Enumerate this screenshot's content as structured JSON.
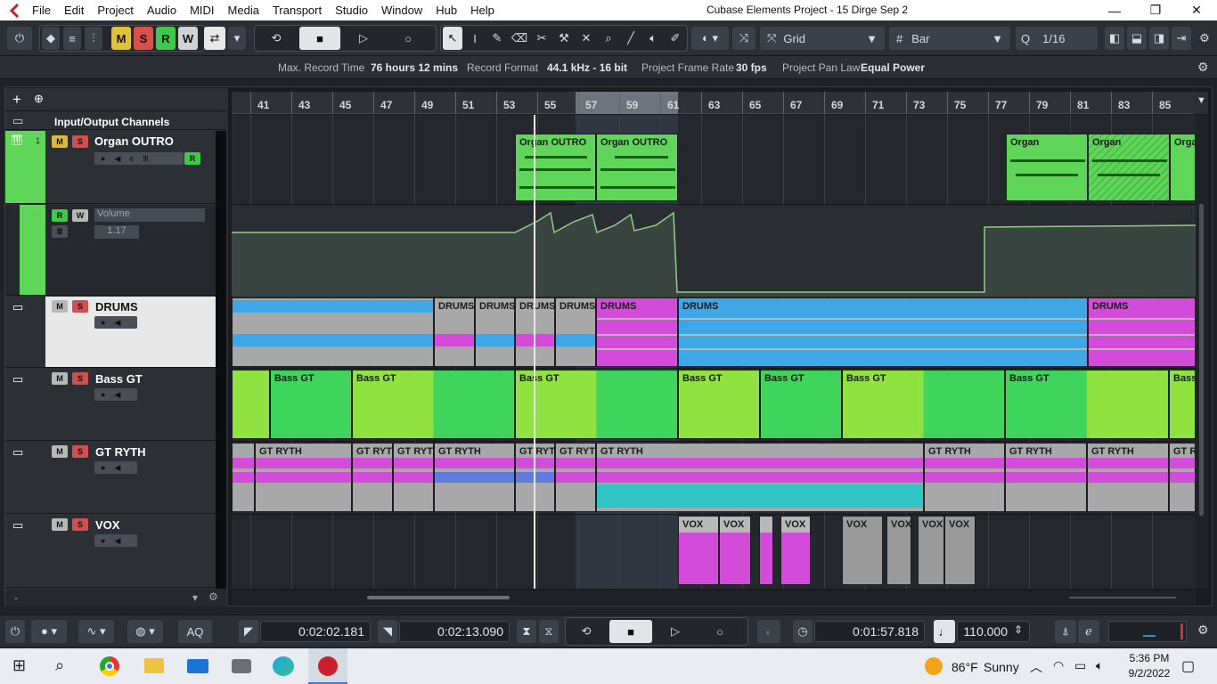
{
  "menu": [
    "File",
    "Edit",
    "Project",
    "Audio",
    "MIDI",
    "Media",
    "Transport",
    "Studio",
    "Window",
    "Hub",
    "Help"
  ],
  "window_title": "Cubase Elements Project - 15 Dirge Sep 2",
  "window_controls": {
    "minimize": "—",
    "restore": "❐",
    "close": "✕"
  },
  "toolbar": {
    "msrw": [
      "M",
      "S",
      "R",
      "W"
    ],
    "snap_type": "Grid",
    "grid_type": "Bar",
    "quantize": "1/16"
  },
  "infobar": {
    "max_record_label": "Max. Record Time",
    "max_record_value": "76 hours 12 mins",
    "record_format_label": "Record Format",
    "record_format_value": "44.1 kHz - 16 bit",
    "frame_rate_label": "Project Frame Rate",
    "frame_rate_value": "30 fps",
    "pan_law_label": "Project Pan Law",
    "pan_law_value": "Equal Power"
  },
  "ruler": {
    "bars": [
      "41",
      "43",
      "45",
      "47",
      "49",
      "51",
      "53",
      "55",
      "57",
      "59",
      "61",
      "63",
      "65",
      "67",
      "69",
      "71",
      "73",
      "75",
      "77",
      "79",
      "81",
      "83",
      "85"
    ]
  },
  "tracks": {
    "io_label": "Input/Output Channels",
    "organ": {
      "number": "1",
      "name": "Organ OUTRO",
      "m": "M",
      "s": "S",
      "r": "R"
    },
    "automation": {
      "r": "R",
      "w": "W",
      "param": "Volume",
      "value": "1.17"
    },
    "drums": {
      "name": "DRUMS",
      "m": "M",
      "s": "S"
    },
    "bass": {
      "name": "Bass GT",
      "m": "M",
      "s": "S"
    },
    "gtryth": {
      "name": "GT RYTH",
      "m": "M",
      "s": "S"
    },
    "vox": {
      "name": "VOX",
      "m": "M",
      "s": "S"
    }
  },
  "clips": {
    "organ": [
      "Organ OUTRO",
      "Organ OUTRO",
      "Organ",
      "Organ",
      "Orga"
    ],
    "drums": [
      "DRUMS",
      "DRUMS",
      "DRUMS",
      "DRUMS",
      "DRUMS",
      "DRUMS",
      "DRUMS"
    ],
    "bass": [
      "Bass GT",
      "Bass GT",
      "Bass GT",
      "Bass GT",
      "Bass GT",
      "Bass GT",
      "Bass GT",
      "Bass"
    ],
    "gtryth": [
      "GT RYTH",
      "GT RYTI",
      "GT RYTI",
      "GT RYTH",
      "GT RYTI",
      "GT RYTH",
      "GT RYTH",
      "GT RYTH",
      "GT RYTH",
      "GT RYTH",
      "GT R"
    ],
    "vox": [
      "VOX",
      "VOX",
      "VOX",
      "VOX",
      "VOX",
      "VOX",
      "VOX"
    ]
  },
  "transport": {
    "aq": "AQ",
    "left_locator": "0:02:02.181",
    "right_locator": "0:02:13.090",
    "position": "0:01:57.818",
    "tempo": "110.000"
  },
  "taskbar": {
    "weather_temp": "86°F",
    "weather_text": "Sunny",
    "time": "5:36 PM",
    "date": "9/2/2022"
  },
  "colors": {
    "organ": "#5fd65a",
    "drums_blue": "#3fa7e6",
    "drums_pink": "#d24bd9",
    "bass_green": "#3fd45c",
    "bass_lime": "#8fe23f",
    "gt_pink": "#d24bd9",
    "gt_teal": "#31c4c4",
    "vox_pink": "#d24bd9"
  }
}
